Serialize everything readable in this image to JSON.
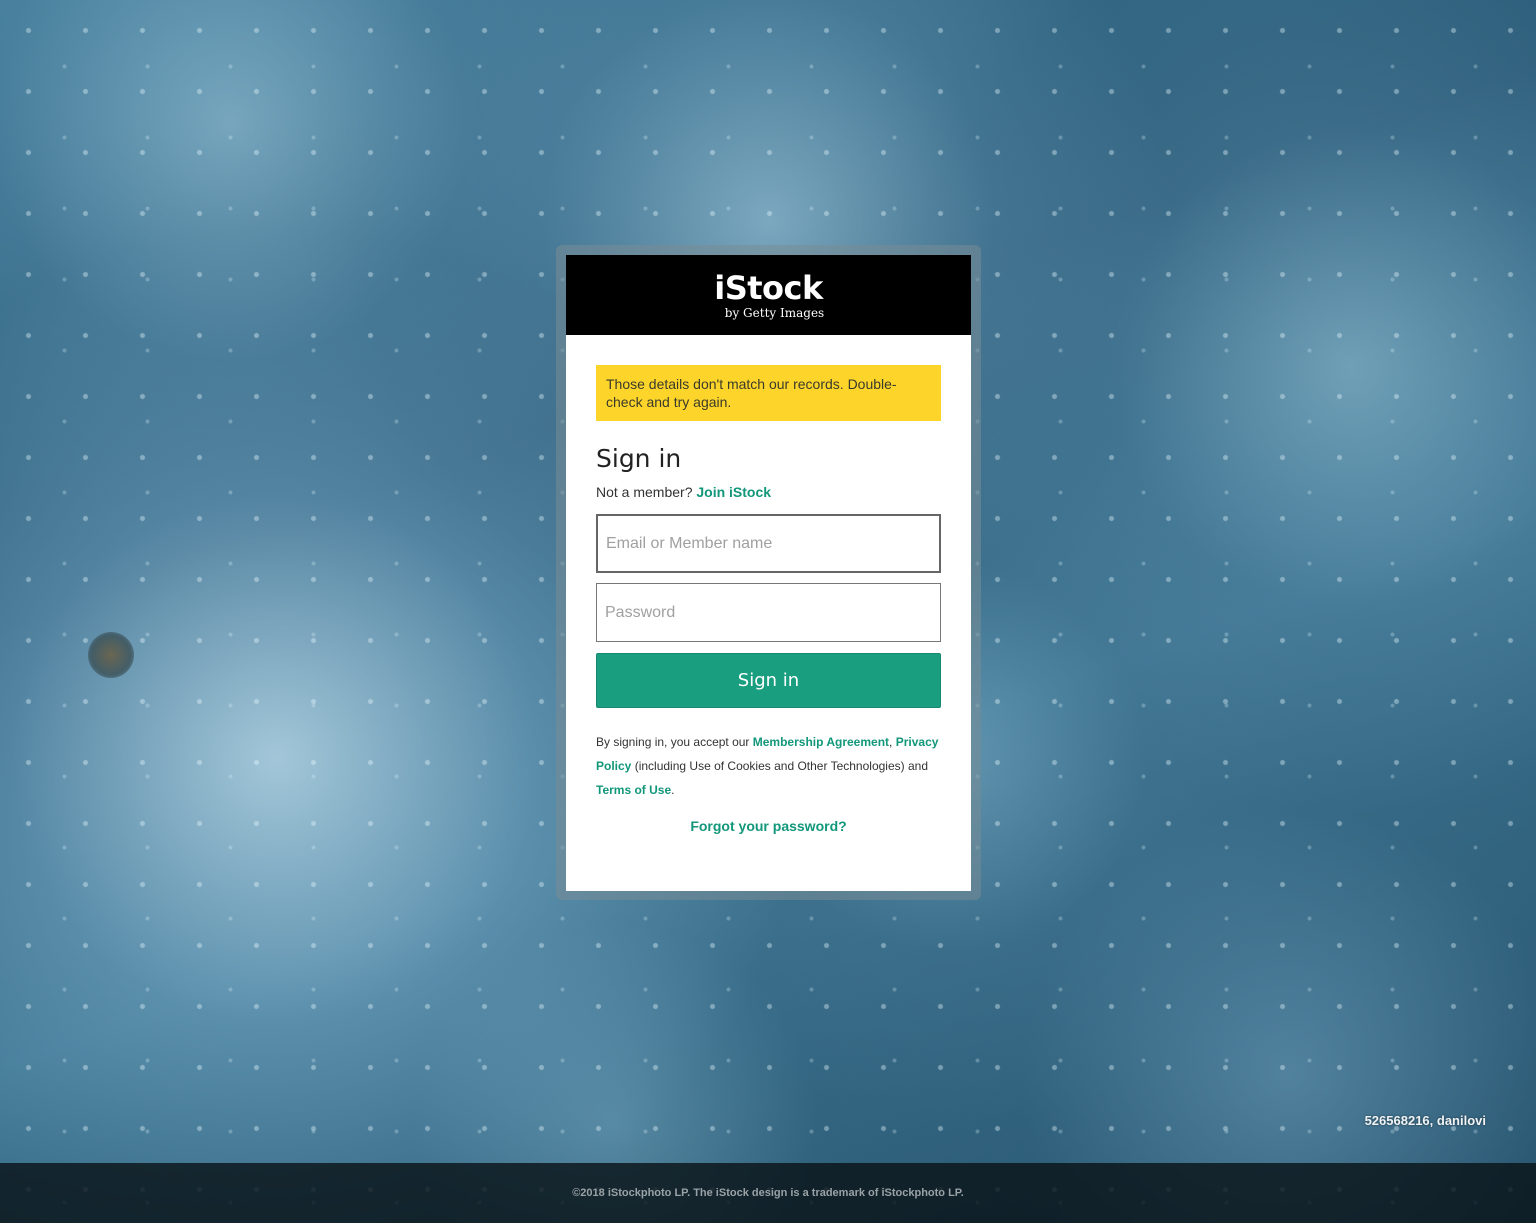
{
  "header": {
    "logo_main": "iStock",
    "logo_sub": "by Getty Images"
  },
  "error": {
    "message": "Those details don't match our records. Double-check and try again."
  },
  "signin": {
    "title": "Sign in",
    "member_prompt": "Not a member?",
    "join_link": "Join iStock",
    "email_placeholder": "Email or Member name",
    "password_placeholder": "Password",
    "submit_label": "Sign in"
  },
  "legal": {
    "prefix": "By signing in, you accept our",
    "membership_agreement": "Membership Agreement",
    "comma": ",",
    "privacy_policy": "Privacy Policy",
    "middle": "(including Use of Cookies and Other Technologies) and",
    "terms_of_use": "Terms of Use",
    "suffix": "."
  },
  "forgot_password": "Forgot your password?",
  "image_caption": "526568216, danilovi",
  "footer": {
    "copyright": "©2018 iStockphoto LP. The iStock design is a trademark of iStockphoto LP."
  },
  "colors": {
    "accent": "#1a9e80",
    "link": "#12977a",
    "error_bg": "#fdd52a",
    "header_bg": "#000000"
  }
}
